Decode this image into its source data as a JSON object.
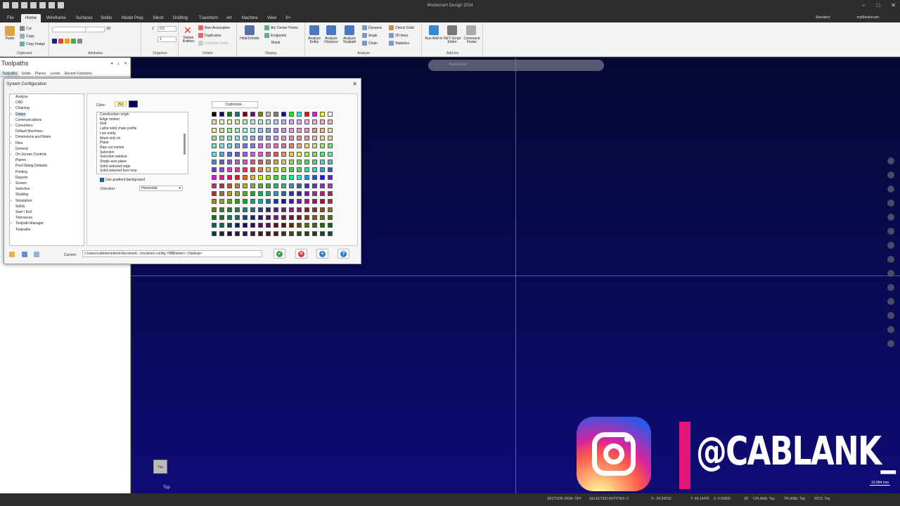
{
  "app": {
    "title": "Mastercam Design 2024"
  },
  "menu": {
    "tabs": [
      "File",
      "Home",
      "Wireframe",
      "Surfaces",
      "Solids",
      "Model Prep",
      "Mesh",
      "Drafting",
      "Transform",
      "Art",
      "Machine",
      "View",
      "X+"
    ],
    "active": "Home",
    "workspace": "Standard",
    "account": "myMastercam"
  },
  "ribbon": {
    "clipboard": {
      "label": "Clipboard",
      "paste": "Paste",
      "cut": "Cut",
      "copy": "Copy",
      "copy_image": "Copy Image"
    },
    "attributes": {
      "label": "Attributes",
      "dim": "3D"
    },
    "organize": {
      "label": "Organize",
      "z_label": "Z",
      "z_value": "0.0",
      "level_value": "1"
    },
    "delete": {
      "label": "Delete",
      "delete_entities": "Delete Entities",
      "non_associative": "Non-Associative",
      "duplicates": "Duplicates",
      "undelete": "Undelete Entity"
    },
    "display": {
      "label": "Display",
      "hide_unhide": "Hide/Unhide",
      "arc_center": "Arc Center Points",
      "endpoints": "Endpoints",
      "blank": "Blank"
    },
    "analyze": {
      "label": "Analyze",
      "analyze_entity": "Analyze Entity",
      "analyze_distance": "Analyze Distance",
      "analyze_toolpath": "Analyze Toolpath",
      "dynamic": "Dynamic",
      "angle": "Angle",
      "chain": "Chain",
      "check_solid": "Check Solid",
      "area_2d": "2D Area",
      "statistics": "Statistics"
    },
    "addins": {
      "label": "Add-Ins",
      "run_addin": "Run Add-In",
      "net_script": "NET-Script Editor",
      "command_finder": "Command Finder"
    }
  },
  "left_panel": {
    "title": "Toolpaths",
    "tabs": [
      "Toolpaths",
      "Solids",
      "Planes",
      "Levels",
      "Recent Functions"
    ]
  },
  "viewport": {
    "autocursor": "AutoCursor",
    "view_cube_label": "Top",
    "view_name": "Top",
    "scale": "10.984 mm"
  },
  "dialog": {
    "title": "System Configuration",
    "tree": [
      {
        "label": "Analyze",
        "expand": ""
      },
      {
        "label": "CAD",
        "expand": ""
      },
      {
        "label": "Chaining",
        "expand": "+"
      },
      {
        "label": "Colors",
        "expand": "+",
        "selected": true
      },
      {
        "label": "Communications",
        "expand": ""
      },
      {
        "label": "Converters",
        "expand": "+"
      },
      {
        "label": "Default Machines",
        "expand": ""
      },
      {
        "label": "Dimensions and Notes",
        "expand": "+"
      },
      {
        "label": "Files",
        "expand": "+"
      },
      {
        "label": "General",
        "expand": ""
      },
      {
        "label": "On-Screen Controls",
        "expand": "+"
      },
      {
        "label": "Planes",
        "expand": ""
      },
      {
        "label": "Post Dialog Defaults",
        "expand": ""
      },
      {
        "label": "Printing",
        "expand": ""
      },
      {
        "label": "Reports",
        "expand": ""
      },
      {
        "label": "Screen",
        "expand": "+"
      },
      {
        "label": "Selection",
        "expand": ""
      },
      {
        "label": "Shading",
        "expand": ""
      },
      {
        "label": "Simulation",
        "expand": "+"
      },
      {
        "label": "Solids",
        "expand": ""
      },
      {
        "label": "Start / Exit",
        "expand": ""
      },
      {
        "label": "Tolerances",
        "expand": ""
      },
      {
        "label": "Toolpath Manager",
        "expand": "+"
      },
      {
        "label": "Toolpaths",
        "expand": ""
      }
    ],
    "color_label": "Color:",
    "color_value": "253",
    "color_swatch": "#000060",
    "customize": "Customize...",
    "items": [
      "Construction origin",
      "Edge motion",
      "Grid",
      "Lathe solid chain profile",
      "Live entity",
      "Mask only on",
      "Plane",
      "Raw cut motion",
      "Selection",
      "Selection window",
      "Single-axis plane",
      "Solid selected edge",
      "Solid selected face loop"
    ],
    "gradient_checkbox": "Use gradient background",
    "direction_label": "Direction:",
    "direction_value": "Horizontal",
    "current_label": "Current:",
    "current_path": "c:\\users\\cabla\\onedrive\\document...\\mcamxm.config <Millimeter> <Startup>"
  },
  "watermark": {
    "handle": "@CABLANK_"
  },
  "status": {
    "section_view": "SECTION VIEW: OFF",
    "selected": "SELECTED ENTITIES: 0",
    "x": "X: -24.54233",
    "y": "Y: 69.16476",
    "z": "Z: 0.00000",
    "mode": "3D",
    "cplane": "CPLANE: Top",
    "tplane": "TPLANE: Top",
    "wcs": "WCS: Top"
  },
  "colors": {
    "accent": "#0078d4",
    "viewport_top": "#060833",
    "viewport_bottom": "#100b76",
    "pink": "#e0167a"
  }
}
